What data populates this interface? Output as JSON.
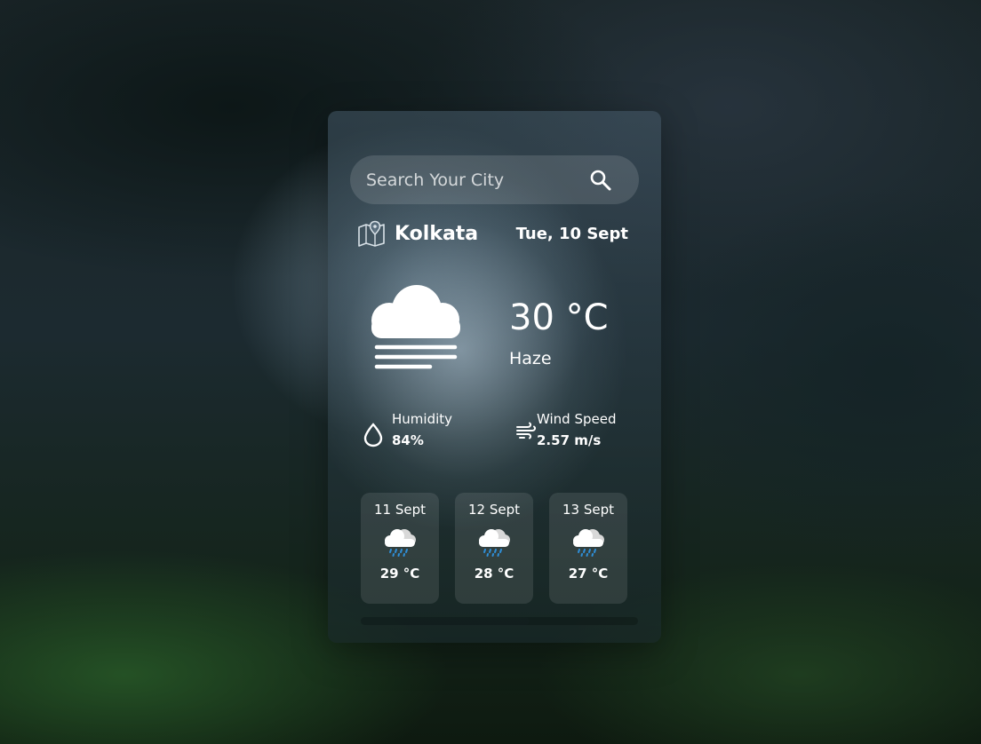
{
  "search": {
    "placeholder": "Search Your City",
    "value": ""
  },
  "location": {
    "city": "Kolkata",
    "date": "Tue, 10 Sept"
  },
  "current": {
    "temperature": "30 °C",
    "condition": "Haze",
    "icon": "haze-cloud-icon"
  },
  "stats": {
    "humidity": {
      "label": "Humidity",
      "value": "84%",
      "icon": "droplet-icon"
    },
    "wind": {
      "label": "Wind Speed",
      "value": "2.57 m/s",
      "icon": "wind-icon"
    }
  },
  "forecast": [
    {
      "date": "11 Sept",
      "temp": "29 °C",
      "icon": "rain-cloud-icon"
    },
    {
      "date": "12 Sept",
      "temp": "28 °C",
      "icon": "rain-cloud-icon"
    },
    {
      "date": "13 Sept",
      "temp": "27 °C",
      "icon": "rain-cloud-icon"
    }
  ],
  "colors": {
    "rain_drop": "#2f8fd8",
    "text": "#ffffff"
  }
}
